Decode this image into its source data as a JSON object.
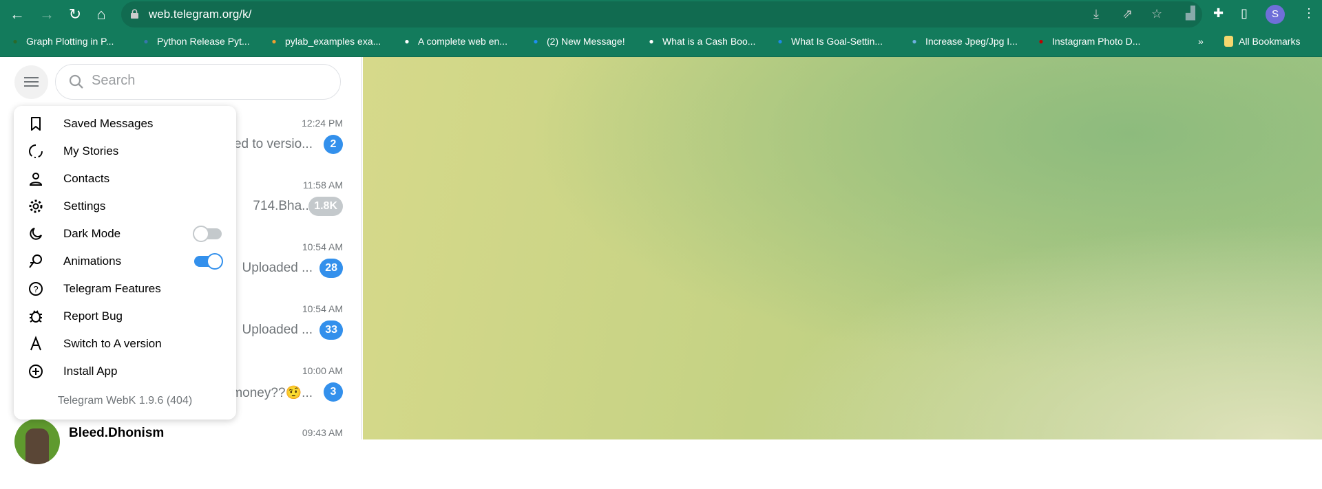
{
  "browser": {
    "url": "web.telegram.org/k/",
    "profile_initial": "S",
    "bookmarks": [
      {
        "label": "Graph Plotting in P...",
        "icon": "scissors-icon",
        "color": "#2a6a2a"
      },
      {
        "label": "Python Release Pyt...",
        "icon": "python-icon",
        "color": "#3776ab"
      },
      {
        "label": "pylab_examples exa...",
        "icon": "matplotlib-icon",
        "color": "#f0a030"
      },
      {
        "label": "A complete web en...",
        "icon": "globe-icon",
        "color": "#ffffff"
      },
      {
        "label": "(2) New Message!",
        "icon": "github-icon",
        "color": "#1f8ef1"
      },
      {
        "label": "What is a Cash Boo...",
        "icon": "tb-icon",
        "color": "#ffffff"
      },
      {
        "label": "What Is Goal-Settin...",
        "icon": "info-icon",
        "color": "#1e88e5"
      },
      {
        "label": "Increase Jpeg/Jpg I...",
        "icon": "image-icon",
        "color": "#6fb0e0"
      },
      {
        "label": "Instagram Photo D...",
        "icon": "ba-icon",
        "color": "#c00000"
      }
    ],
    "more": "»",
    "all_bookmarks": "All Bookmarks"
  },
  "search": {
    "placeholder": "Search"
  },
  "chats": [
    {
      "time": "12:24 PM",
      "preview": "ed to versio...",
      "badge": "2",
      "muted": false
    },
    {
      "time": "11:58 AM",
      "preview": "714.Bha...",
      "badge": "1.8K",
      "muted": true
    },
    {
      "time": "10:54 AM",
      "preview": "Uploaded ...",
      "badge": "28",
      "muted": false
    },
    {
      "time": "10:54 AM",
      "preview": "Uploaded ...",
      "badge": "33",
      "muted": false
    },
    {
      "time": "10:00 AM",
      "preview": "money??🤨...",
      "badge": "3",
      "muted": false
    },
    {
      "time": "09:43 AM",
      "name": "Bleed.Dhonism"
    }
  ],
  "menu": {
    "items": [
      {
        "label": "Saved Messages",
        "icon": "bookmark-icon"
      },
      {
        "label": "My Stories",
        "icon": "stories-icon"
      },
      {
        "label": "Contacts",
        "icon": "user-icon"
      },
      {
        "label": "Settings",
        "icon": "gear-icon"
      },
      {
        "label": "Dark Mode",
        "icon": "moon-icon",
        "toggle": false
      },
      {
        "label": "Animations",
        "icon": "animations-icon",
        "toggle": true
      },
      {
        "label": "Telegram Features",
        "icon": "help-icon"
      },
      {
        "label": "Report Bug",
        "icon": "bug-icon"
      },
      {
        "label": "Switch to A version",
        "icon": "letter-a-icon"
      },
      {
        "label": "Install App",
        "icon": "plus-circle-icon"
      }
    ],
    "version": "Telegram WebK 1.9.6 (404)"
  },
  "colors": {
    "accent": "#3390ec",
    "chrome": "#137b5c",
    "muted_badge": "#c4c9cc"
  }
}
